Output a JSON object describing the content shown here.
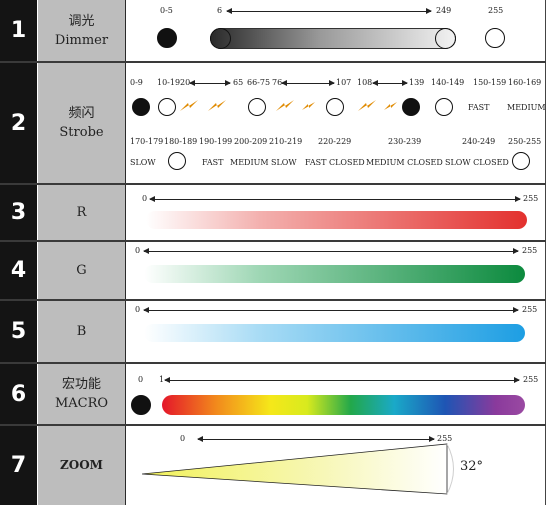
{
  "rows": [
    {
      "num": "1",
      "label_cn": "调光",
      "label_en": "Dimmer"
    },
    {
      "num": "2",
      "label_cn": "频闪",
      "label_en": "Strobe"
    },
    {
      "num": "3",
      "label_cn": "",
      "label_en": "R"
    },
    {
      "num": "4",
      "label_cn": "",
      "label_en": "G"
    },
    {
      "num": "5",
      "label_cn": "",
      "label_en": "B"
    },
    {
      "num": "6",
      "label_cn": "宏功能",
      "label_en": "MACRO"
    },
    {
      "num": "7",
      "label_cn": "",
      "label_en": "ZOOM"
    }
  ],
  "dimmer": {
    "off": "0-5",
    "start": "6",
    "end": "249",
    "full": "255"
  },
  "strobe": {
    "r1": [
      "0-9",
      "10-19",
      "20",
      "65",
      "66-75",
      "76",
      "107",
      "108",
      "139",
      "140-149",
      "150-159",
      "160-169"
    ],
    "r1_words": [
      "FAST",
      "MEDIUM"
    ],
    "r2": [
      "170-179",
      "180-189",
      "190-199",
      "200-209",
      "210-219",
      "220-229",
      "230-239",
      "240-249",
      "250-255"
    ],
    "r3": [
      "SLOW",
      "FAST",
      "MEDIUM",
      "SLOW",
      "FAST CLOSED",
      "MEDIUM CLOSED",
      "SLOW CLOSED"
    ]
  },
  "rgb": {
    "start": "0",
    "end": "255"
  },
  "macro": {
    "off": "0",
    "start": "1",
    "end": "255"
  },
  "zoom": {
    "start": "0",
    "end": "255",
    "angle": "32°"
  },
  "colors": {
    "number_bg": "#141414",
    "label_bg": "#bdbdbd",
    "bolt": "#e08a00",
    "red": "#e3312e",
    "green": "#0c8a3e",
    "blue": "#1d9ee3",
    "zoom_yellow": "#f2f25a"
  }
}
